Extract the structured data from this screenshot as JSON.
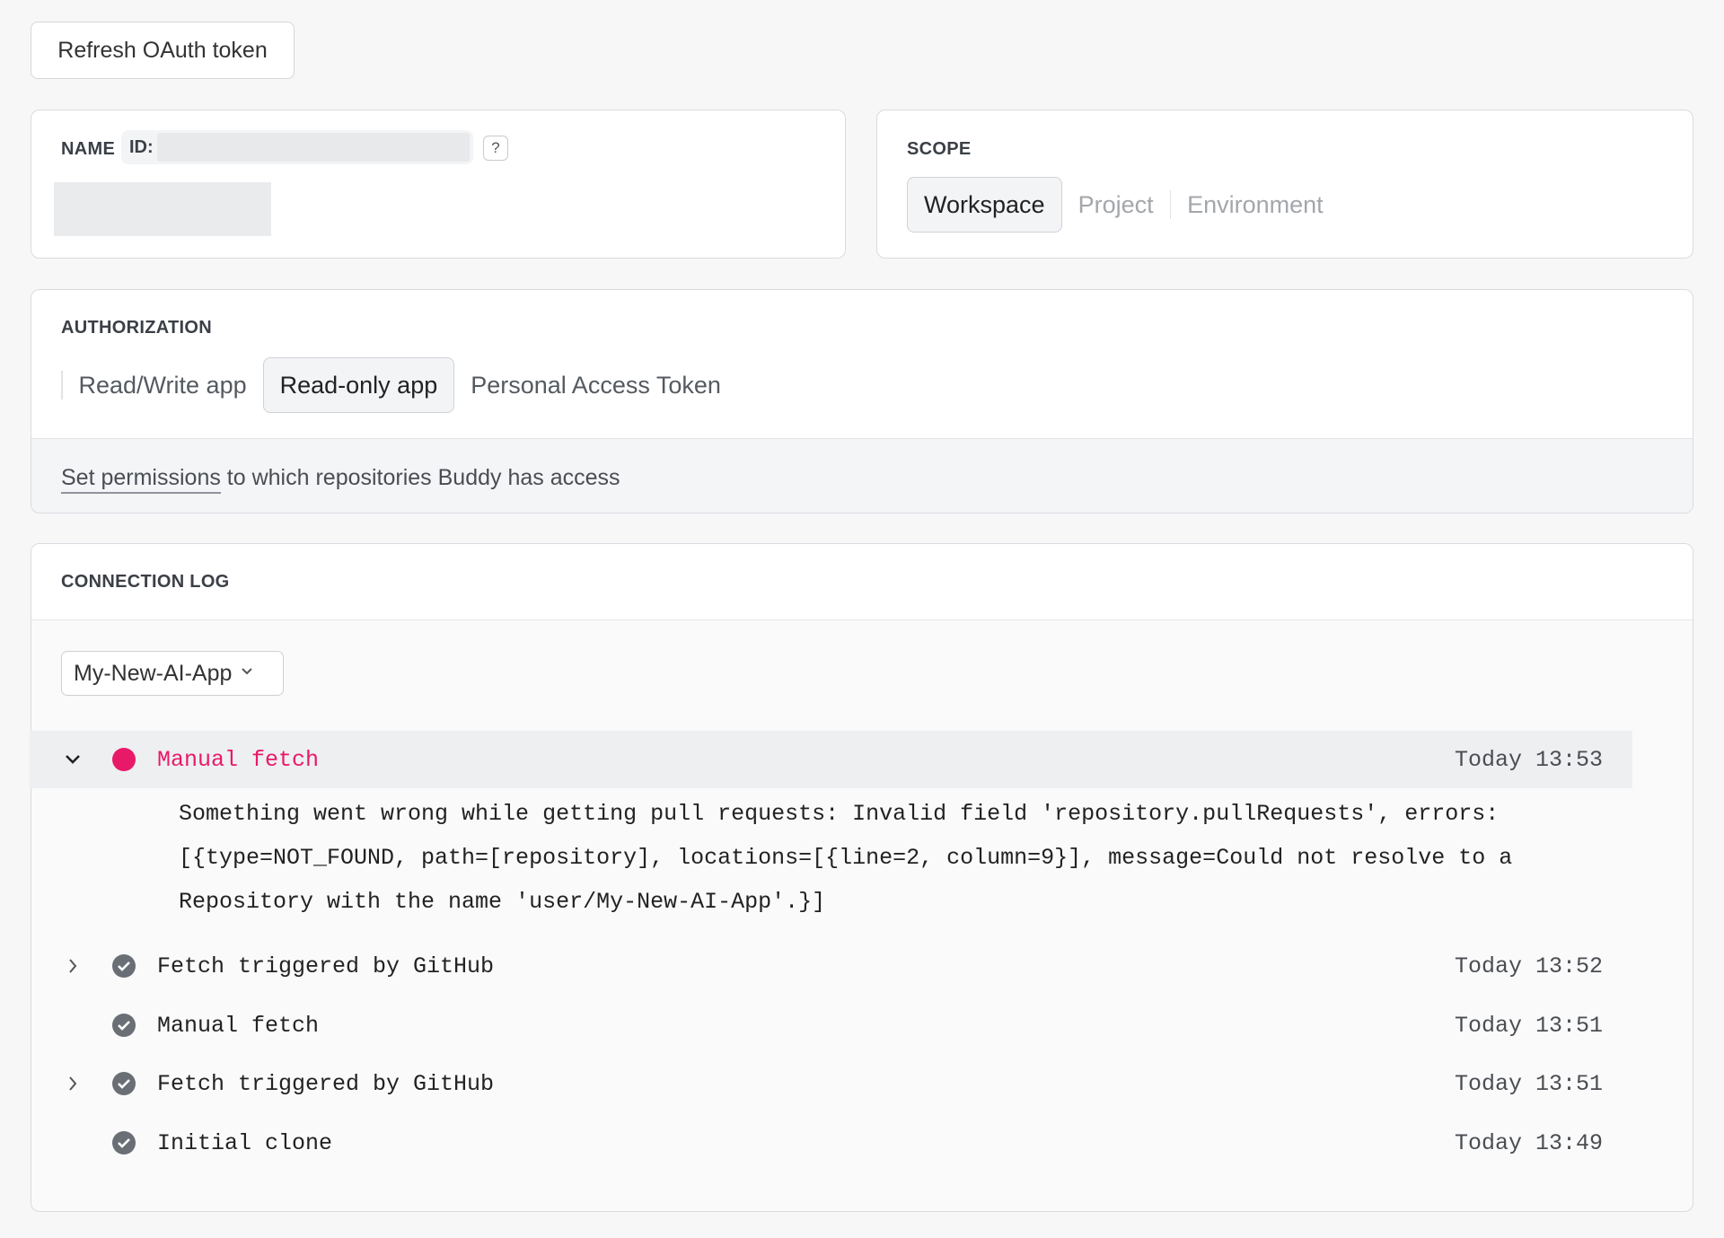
{
  "toolbar": {
    "refresh_label": "Refresh OAuth token"
  },
  "name_card": {
    "label": "NAME",
    "id_label": "ID:",
    "help": "?"
  },
  "scope_card": {
    "label": "SCOPE",
    "options": [
      "Workspace",
      "Project",
      "Environment"
    ],
    "selected": "Workspace"
  },
  "auth_card": {
    "label": "AUTHORIZATION",
    "options": [
      "Read/Write app",
      "Read-only app",
      "Personal Access Token"
    ],
    "selected": "Read-only app",
    "permissions_link": "Set permissions",
    "permissions_rest": " to which repositories Buddy has access"
  },
  "log_card": {
    "label": "CONNECTION LOG",
    "repo_select": "My-New-AI-App",
    "entries": [
      {
        "title": "Manual fetch",
        "time": "Today 13:53",
        "status": "error",
        "toggle": "expanded"
      },
      {
        "title": "Fetch triggered by GitHub",
        "time": "Today 13:52",
        "status": "success",
        "toggle": "collapsed"
      },
      {
        "title": "Manual fetch",
        "time": "Today 13:51",
        "status": "success",
        "toggle": "none"
      },
      {
        "title": "Fetch triggered by GitHub",
        "time": "Today 13:51",
        "status": "success",
        "toggle": "collapsed"
      },
      {
        "title": "Initial clone",
        "time": "Today 13:49",
        "status": "success",
        "toggle": "none"
      }
    ],
    "error_detail": [
      "Something went wrong while getting pull requests: Invalid field 'repository.pullRequests', errors:",
      "[{type=NOT_FOUND, path=[repository], locations=[{line=2, column=9}], message=Could not resolve to a",
      "Repository with the name 'user/My-New-AI-App'.}]"
    ]
  },
  "icons": {
    "chevron_down": "chevron-down-icon",
    "chevron_right": "chevron-right-icon",
    "check": "check-circle-icon",
    "error_dot": "error-status-icon"
  },
  "colors": {
    "error": "#e9196a",
    "success": "#6a6f76"
  }
}
